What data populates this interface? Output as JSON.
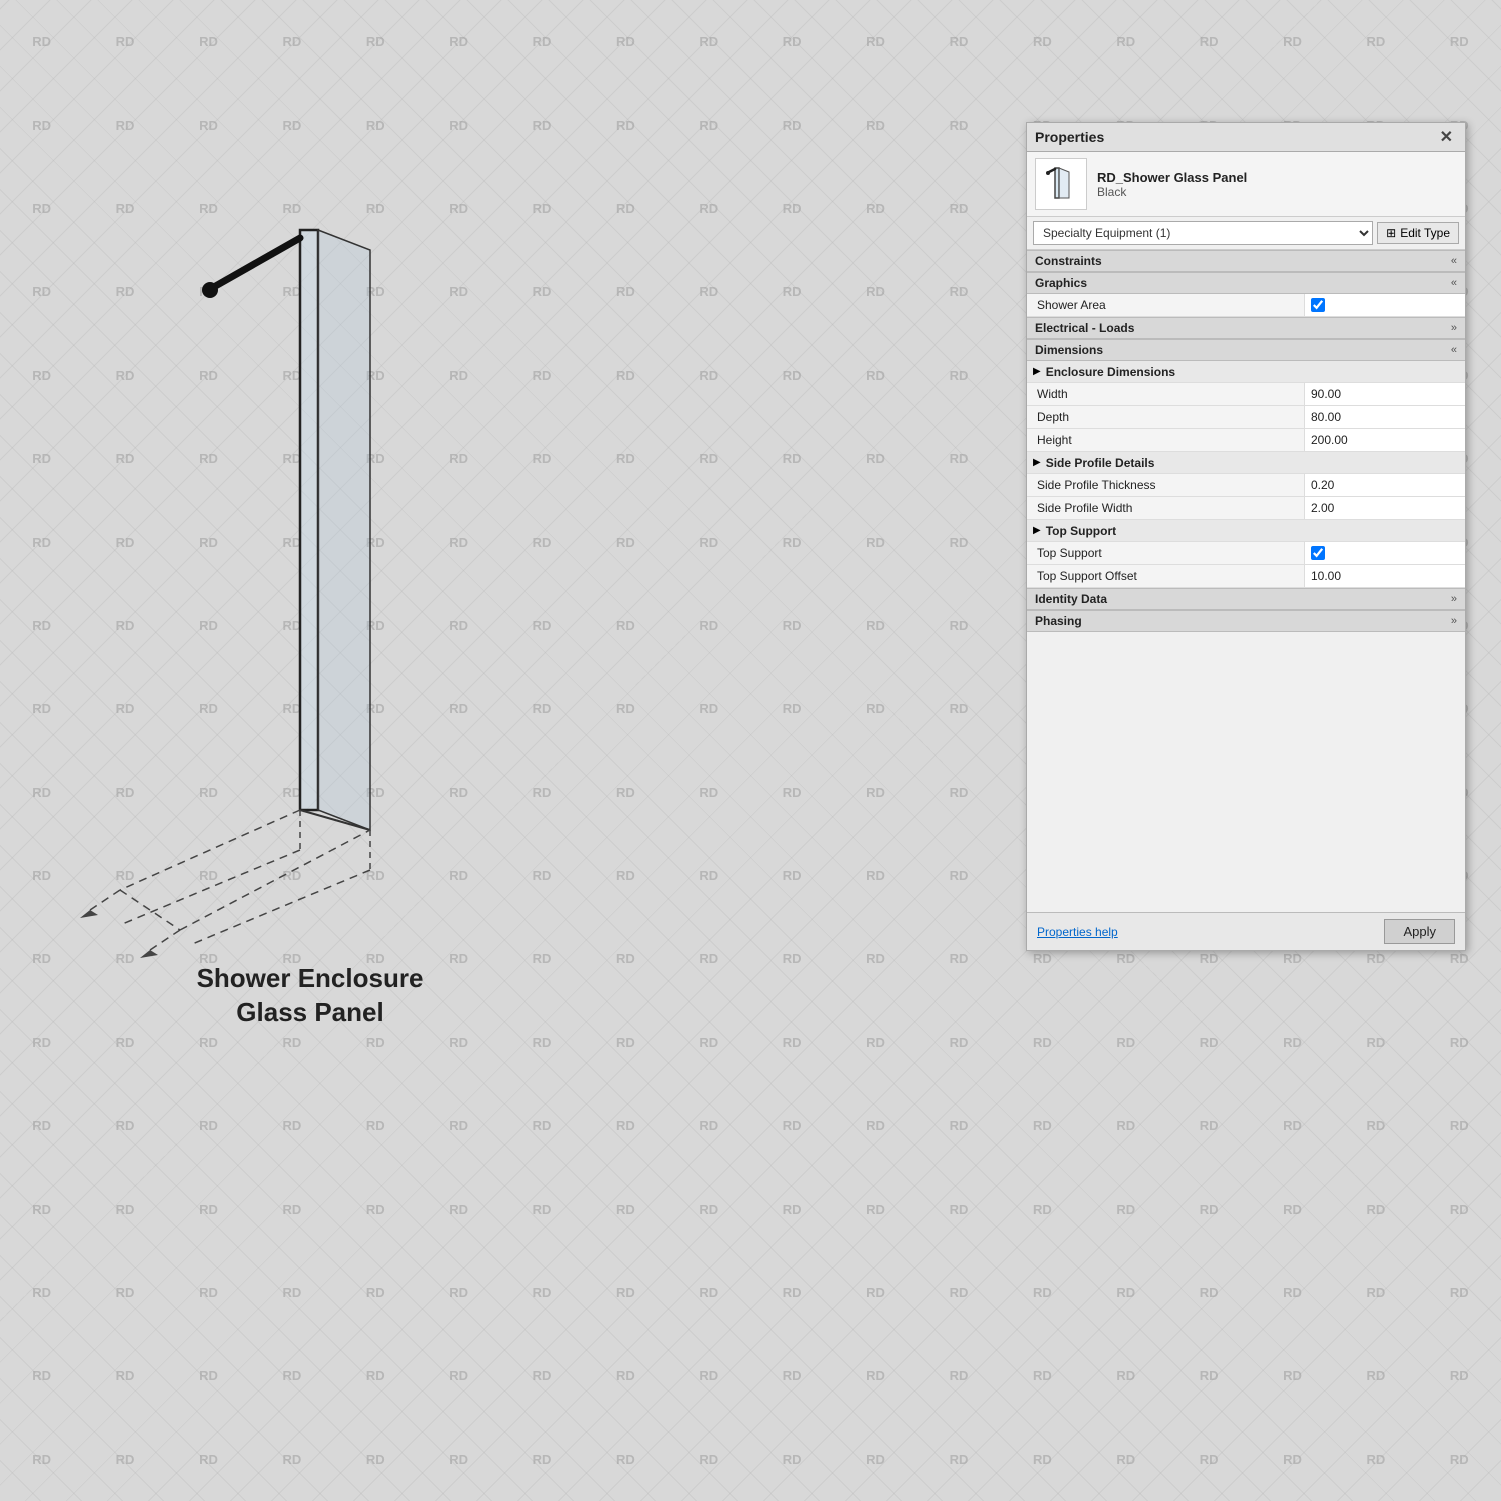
{
  "watermark": {
    "text": "RD"
  },
  "drawing": {
    "label_line1": "Shower Enclosure",
    "label_line2": "Glass Panel"
  },
  "panel": {
    "title": "Properties",
    "close_icon": "✕",
    "component_name": "RD_Shower Glass Panel",
    "component_sub": "Black",
    "selector_value": "Specialty Equipment (1)",
    "edit_type_icon": "⊞",
    "edit_type_label": "Edit Type",
    "sections": {
      "constraints": {
        "label": "Constraints",
        "collapse_icon": "«"
      },
      "graphics": {
        "label": "Graphics",
        "collapse_icon": "«",
        "rows": [
          {
            "label": "Shower Area",
            "value": "checked",
            "type": "checkbox"
          }
        ]
      },
      "electrical_loads": {
        "label": "Electrical - Loads",
        "collapse_icon": "»"
      },
      "dimensions": {
        "label": "Dimensions",
        "collapse_icon": "«",
        "sub_sections": [
          {
            "label": "Enclosure Dimensions",
            "rows": [
              {
                "label": "Width",
                "value": "90.00"
              },
              {
                "label": "Depth",
                "value": "80.00"
              },
              {
                "label": "Height",
                "value": "200.00"
              }
            ]
          },
          {
            "label": "Side Profile Details",
            "rows": [
              {
                "label": "Side Profile Thickness",
                "value": "0.20"
              },
              {
                "label": "Side Profile Width",
                "value": "2.00"
              }
            ]
          },
          {
            "label": "Top Support",
            "rows": [
              {
                "label": "Top Support",
                "value": "checked",
                "type": "checkbox"
              },
              {
                "label": "Top Support Offset",
                "value": "10.00"
              }
            ]
          }
        ]
      },
      "identity_data": {
        "label": "Identity Data",
        "collapse_icon": "»"
      },
      "phasing": {
        "label": "Phasing",
        "collapse_icon": "»"
      }
    },
    "footer": {
      "help_label": "Properties help",
      "apply_label": "Apply"
    }
  }
}
